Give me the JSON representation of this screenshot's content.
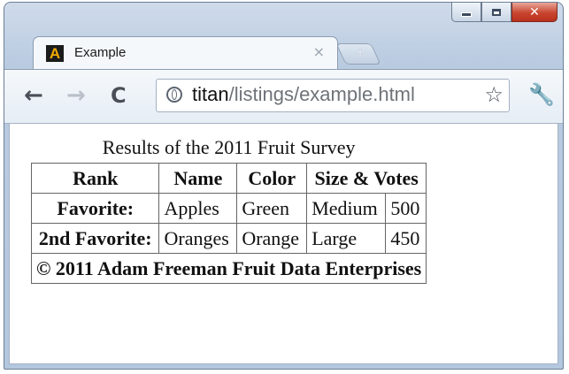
{
  "window": {
    "controls": {
      "minimize_glyph": "",
      "maximize_glyph": "",
      "close_glyph": "✕"
    }
  },
  "tab": {
    "title": "Example",
    "favicon_letter": "A",
    "close_glyph": "×",
    "newtab_glyph": "+"
  },
  "toolbar": {
    "back_glyph": "←",
    "forward_glyph": "→",
    "reload_glyph": "C",
    "url_host": "titan",
    "url_path": "/listings/example.html",
    "star_glyph": "☆",
    "wrench_glyph": "🔧"
  },
  "icons": {
    "favicon": "app-favicon-icon",
    "back": "back-arrow-icon",
    "forward": "forward-arrow-icon",
    "reload": "reload-icon",
    "globe": "globe-icon",
    "star": "star-bookmark-icon",
    "wrench": "wrench-menu-icon"
  },
  "page": {
    "caption": "Results of the 2011 Fruit Survey",
    "headers": [
      "Rank",
      "Name",
      "Color",
      "Size & Votes"
    ],
    "rows": [
      {
        "rank": "Favorite:",
        "name": "Apples",
        "color": "Green",
        "size": "Medium",
        "votes": "500"
      },
      {
        "rank": "2nd Favorite:",
        "name": "Oranges",
        "color": "Orange",
        "size": "Large",
        "votes": "450"
      }
    ],
    "footer": "© 2011 Adam Freeman Fruit Data Enterprises"
  },
  "colors": {
    "window_frame": "#b9cbe0",
    "close_button": "#c9452f",
    "favicon_bg": "#1b1b1b",
    "favicon_fg": "#f2a900"
  }
}
